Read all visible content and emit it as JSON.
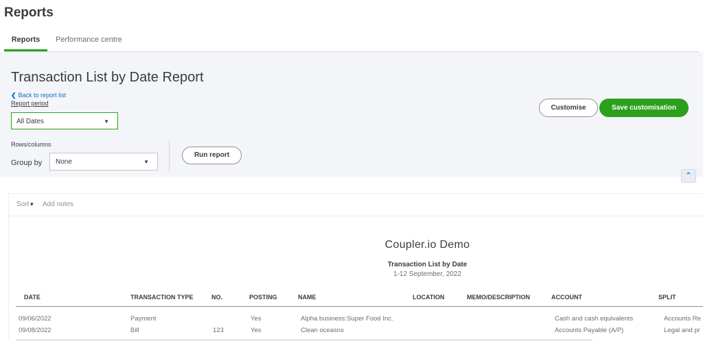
{
  "page": {
    "title": "Reports"
  },
  "tabs": [
    {
      "label": "Reports",
      "active": true
    },
    {
      "label": "Performance centre",
      "active": false
    }
  ],
  "report_header": {
    "title": "Transaction List by Date Report",
    "back_link": "Back to report list",
    "period_label": "Report period",
    "period_value": "All Dates",
    "rows_columns_label": "Rows/columns",
    "group_by_label": "Group by",
    "group_by_value": "None",
    "run_report": "Run report",
    "customise": "Customise",
    "save_customisation": "Save customisation"
  },
  "toolbar": {
    "sort": "Sort",
    "add_notes": "Add notes"
  },
  "report": {
    "company": "Coupler.io Demo",
    "name": "Transaction List by Date",
    "range": "1-12 September, 2022",
    "columns": [
      "DATE",
      "TRANSACTION TYPE",
      "NO.",
      "POSTING",
      "NAME",
      "LOCATION",
      "MEMO/DESCRIPTION",
      "ACCOUNT",
      "SPLIT"
    ],
    "rows": [
      {
        "date": "09/06/2022",
        "type": "Payment",
        "no": "",
        "posting": "Yes",
        "name": "Alpha business:Super Food Inc.",
        "location": "",
        "memo": "",
        "account": "Cash and cash equivalents",
        "split": "Accounts Re"
      },
      {
        "date": "09/08/2022",
        "type": "Bill",
        "no": "123",
        "posting": "Yes",
        "name": "Clean oceasns",
        "location": "",
        "memo": "",
        "account": "Accounts Payable (A/P)",
        "split": "Legal and pr"
      }
    ]
  },
  "icons": {
    "back": "chevron-left-icon",
    "dropdown": "caret-down-icon",
    "sort": "caret-down-icon",
    "collapse": "chevron-up-icon"
  },
  "colors": {
    "accent_green": "#2ca01c",
    "link_blue": "#0077c5",
    "panel_bg": "#f4f5f8"
  }
}
